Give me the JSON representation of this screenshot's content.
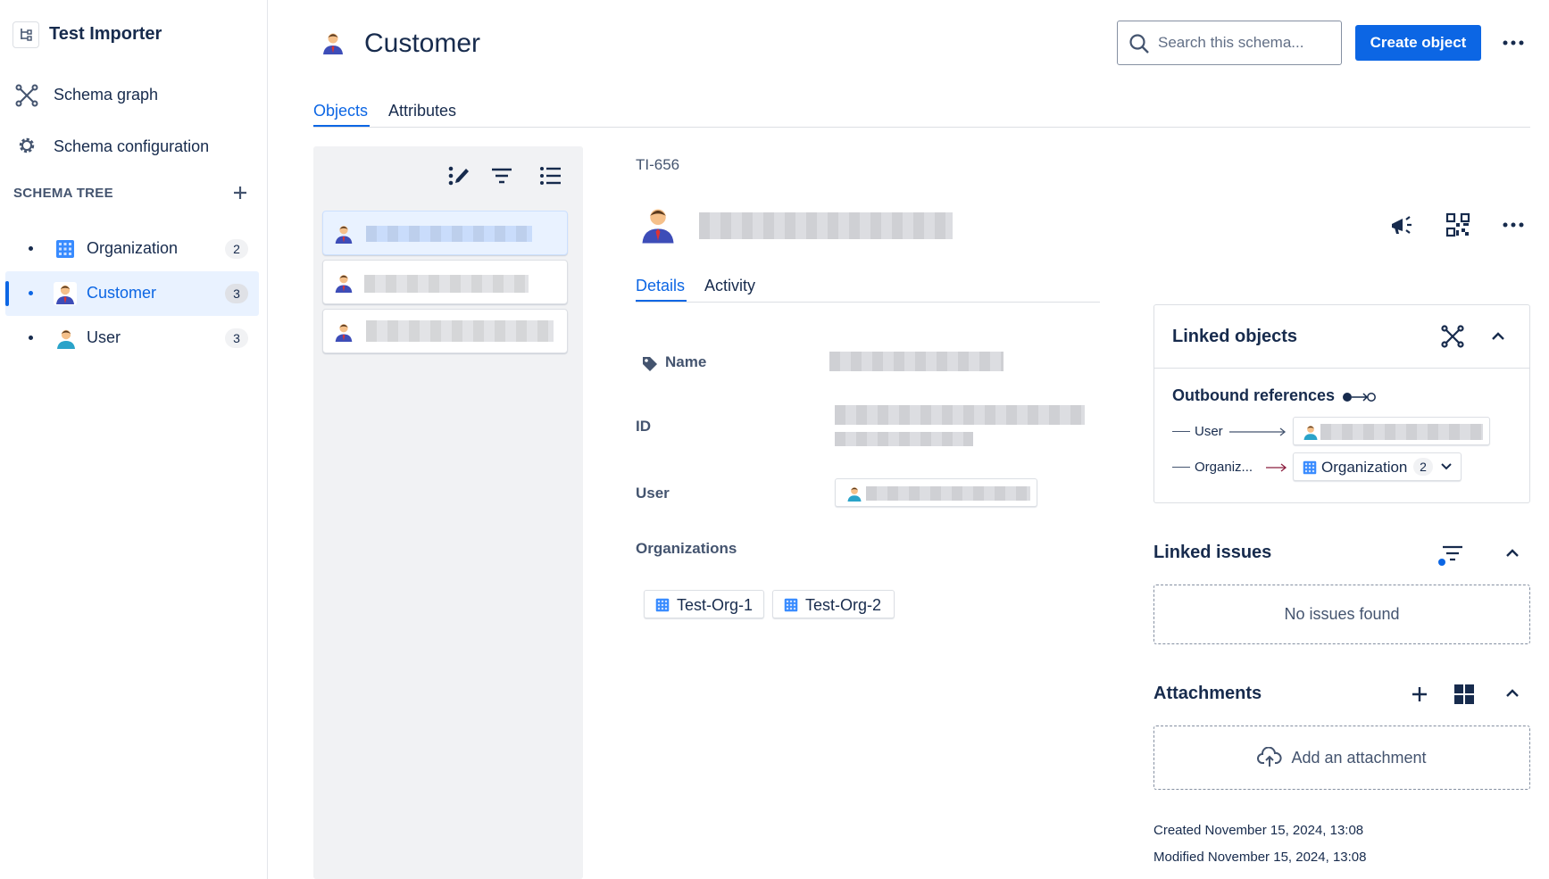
{
  "sidebar": {
    "app_title": "Test Importer",
    "nav": [
      {
        "label": "Schema graph"
      },
      {
        "label": "Schema configuration"
      }
    ],
    "tree_heading": "SCHEMA TREE",
    "tree": [
      {
        "label": "Organization",
        "count": "2"
      },
      {
        "label": "Customer",
        "count": "3"
      },
      {
        "label": "User",
        "count": "3"
      }
    ]
  },
  "header": {
    "title": "Customer",
    "search_placeholder": "Search this schema...",
    "create_label": "Create object",
    "tabs": [
      "Objects",
      "Attributes"
    ]
  },
  "object": {
    "key": "TI-656",
    "tabs": [
      "Details",
      "Activity"
    ],
    "fields": {
      "name_label": "Name",
      "id_label": "ID",
      "user_label": "User",
      "orgs_label": "Organizations"
    },
    "organizations": [
      "Test-Org-1",
      "Test-Org-2"
    ]
  },
  "linked_objects": {
    "title": "Linked objects",
    "outbound_label": "Outbound references",
    "refs": [
      {
        "label": "User"
      },
      {
        "label": "Organiz...",
        "target": "Organization",
        "count": "2"
      }
    ]
  },
  "linked_issues": {
    "title": "Linked issues",
    "empty": "No issues found"
  },
  "attachments": {
    "title": "Attachments",
    "add_label": "Add an attachment"
  },
  "meta": {
    "created": "Created November 15, 2024, 13:08",
    "modified": "Modified November 15, 2024, 13:08"
  }
}
